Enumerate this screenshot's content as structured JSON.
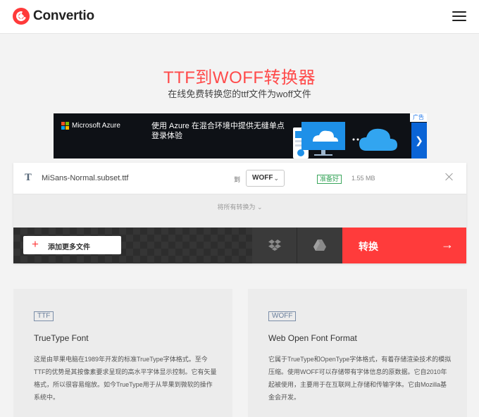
{
  "header": {
    "logo_text": "Convertio"
  },
  "hero": {
    "title": "TTF到WOFF转换器",
    "subtitle": "在线免费转换您的ttf文件为woff文件"
  },
  "ad": {
    "brand": "Microsoft Azure",
    "copy": "使用 Azure 在混合环境中提供无缝单点登录体验",
    "badge": "广告",
    "colors": {
      "ms_red": "#f25022",
      "ms_green": "#7fba00",
      "ms_blue": "#00a4ef",
      "ms_yellow": "#ffb900"
    }
  },
  "file": {
    "name": "MiSans-Normal.subset.ttf",
    "to_label": "到",
    "format": "WOFF",
    "status": "准备好",
    "size": "1.55 MB"
  },
  "convert_all_label": "将所有转换为",
  "actions": {
    "add_files": "添加更多文件",
    "convert": "转换"
  },
  "formats": [
    {
      "tag": "TTF",
      "name": "TrueType Font",
      "desc": "这是由苹果电脑在1989年开发的标准TrueType字体格式。至今TTF的优势是其按像素要求呈现的高水平字体显示控制。它有矢量格式，所以很容易缩放。如今TrueType用于从苹果到微软的操作系统中。"
    },
    {
      "tag": "WOFF",
      "name": "Web Open Font Format",
      "desc": "它属于TrueType和OpenType字体格式，有着存储渲染技术的模拟压缩。使用WOFF可以存储带有字体信息的原数据。它自2010年起被使用，主要用于在互联网上存储和传输字体。它由Mozilla基金会开发。"
    }
  ],
  "colors": {
    "accent": "#ff3b3b",
    "ready": "#3aa65c"
  }
}
